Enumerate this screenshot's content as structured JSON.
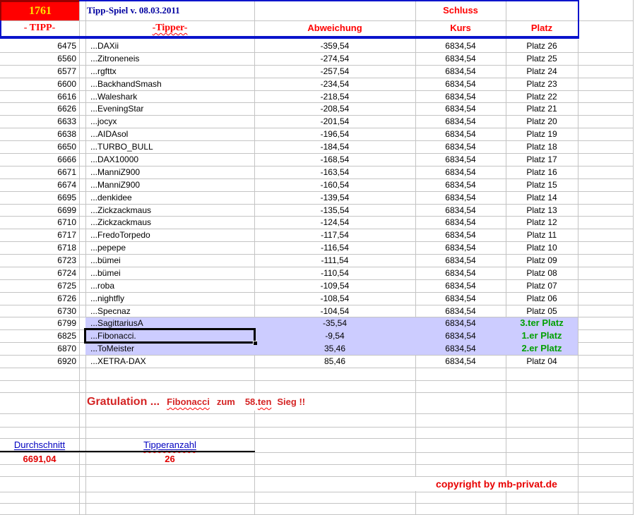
{
  "header": {
    "game_number": "1761",
    "title": "Tipp-Spiel v. 08.03.2011",
    "col_tipp": "- TIPP-",
    "col_tipper": "-Tipper-",
    "col_abweichung": "Abweichung",
    "col_schluss": "Schluss",
    "col_kurs": "Kurs",
    "col_platz": "Platz"
  },
  "table": {
    "rows": [
      {
        "tipp": "6475",
        "tipper": "...DAXii",
        "abweichung": "-359,54",
        "kurs": "6834,54",
        "platz": "Platz 26",
        "highlight": false,
        "winner": false,
        "selected": false
      },
      {
        "tipp": "6560",
        "tipper": "...Zitroneneis",
        "abweichung": "-274,54",
        "kurs": "6834,54",
        "platz": "Platz 25",
        "highlight": false,
        "winner": false,
        "selected": false
      },
      {
        "tipp": "6577",
        "tipper": "...rgfttx",
        "abweichung": "-257,54",
        "kurs": "6834,54",
        "platz": "Platz 24",
        "highlight": false,
        "winner": false,
        "selected": false
      },
      {
        "tipp": "6600",
        "tipper": "...BackhandSmash",
        "abweichung": "-234,54",
        "kurs": "6834,54",
        "platz": "Platz 23",
        "highlight": false,
        "winner": false,
        "selected": false
      },
      {
        "tipp": "6616",
        "tipper": "...Waleshark",
        "abweichung": "-218,54",
        "kurs": "6834,54",
        "platz": "Platz 22",
        "highlight": false,
        "winner": false,
        "selected": false
      },
      {
        "tipp": "6626",
        "tipper": "...EveningStar",
        "abweichung": "-208,54",
        "kurs": "6834,54",
        "platz": "Platz 21",
        "highlight": false,
        "winner": false,
        "selected": false
      },
      {
        "tipp": "6633",
        "tipper": "...jocyx",
        "abweichung": "-201,54",
        "kurs": "6834,54",
        "platz": "Platz 20",
        "highlight": false,
        "winner": false,
        "selected": false
      },
      {
        "tipp": "6638",
        "tipper": "...AIDAsol",
        "abweichung": "-196,54",
        "kurs": "6834,54",
        "platz": "Platz 19",
        "highlight": false,
        "winner": false,
        "selected": false
      },
      {
        "tipp": "6650",
        "tipper": "...TURBO_BULL",
        "abweichung": "-184,54",
        "kurs": "6834,54",
        "platz": "Platz 18",
        "highlight": false,
        "winner": false,
        "selected": false
      },
      {
        "tipp": "6666",
        "tipper": "...DAX10000",
        "abweichung": "-168,54",
        "kurs": "6834,54",
        "platz": "Platz 17",
        "highlight": false,
        "winner": false,
        "selected": false
      },
      {
        "tipp": "6671",
        "tipper": "...ManniZ900",
        "abweichung": "-163,54",
        "kurs": "6834,54",
        "platz": "Platz 16",
        "highlight": false,
        "winner": false,
        "selected": false
      },
      {
        "tipp": "6674",
        "tipper": "...ManniZ900",
        "abweichung": "-160,54",
        "kurs": "6834,54",
        "platz": "Platz 15",
        "highlight": false,
        "winner": false,
        "selected": false
      },
      {
        "tipp": "6695",
        "tipper": "...denkidee",
        "abweichung": "-139,54",
        "kurs": "6834,54",
        "platz": "Platz 14",
        "highlight": false,
        "winner": false,
        "selected": false
      },
      {
        "tipp": "6699",
        "tipper": "...Zickzackmaus",
        "abweichung": "-135,54",
        "kurs": "6834,54",
        "platz": "Platz 13",
        "highlight": false,
        "winner": false,
        "selected": false
      },
      {
        "tipp": "6710",
        "tipper": "...Zickzackmaus",
        "abweichung": "-124,54",
        "kurs": "6834,54",
        "platz": "Platz 12",
        "highlight": false,
        "winner": false,
        "selected": false
      },
      {
        "tipp": "6717",
        "tipper": "...FredoTorpedo",
        "abweichung": "-117,54",
        "kurs": "6834,54",
        "platz": "Platz 11",
        "highlight": false,
        "winner": false,
        "selected": false
      },
      {
        "tipp": "6718",
        "tipper": "...pepepe",
        "abweichung": "-116,54",
        "kurs": "6834,54",
        "platz": "Platz 10",
        "highlight": false,
        "winner": false,
        "selected": false
      },
      {
        "tipp": "6723",
        "tipper": "...bümei",
        "abweichung": "-111,54",
        "kurs": "6834,54",
        "platz": "Platz 09",
        "highlight": false,
        "winner": false,
        "selected": false
      },
      {
        "tipp": "6724",
        "tipper": "...bümei",
        "abweichung": "-110,54",
        "kurs": "6834,54",
        "platz": "Platz 08",
        "highlight": false,
        "winner": false,
        "selected": false
      },
      {
        "tipp": "6725",
        "tipper": "...roba",
        "abweichung": "-109,54",
        "kurs": "6834,54",
        "platz": "Platz 07",
        "highlight": false,
        "winner": false,
        "selected": false
      },
      {
        "tipp": "6726",
        "tipper": "...nightfly",
        "abweichung": "-108,54",
        "kurs": "6834,54",
        "platz": "Platz 06",
        "highlight": false,
        "winner": false,
        "selected": false
      },
      {
        "tipp": "6730",
        "tipper": "...Specnaz",
        "abweichung": "-104,54",
        "kurs": "6834,54",
        "platz": "Platz 05",
        "highlight": false,
        "winner": false,
        "selected": false
      },
      {
        "tipp": "6799",
        "tipper": "...SagittariusA",
        "abweichung": "-35,54",
        "kurs": "6834,54",
        "platz": "3.ter Platz",
        "highlight": true,
        "winner": true,
        "selected": false
      },
      {
        "tipp": "6825",
        "tipper": "...Fibonacci.",
        "abweichung": "-9,54",
        "kurs": "6834,54",
        "platz": "1.er Platz",
        "highlight": true,
        "winner": true,
        "selected": true
      },
      {
        "tipp": "6870",
        "tipper": "...ToMeister",
        "abweichung": "35,46",
        "kurs": "6834,54",
        "platz": "2.er Platz",
        "highlight": true,
        "winner": true,
        "selected": false
      },
      {
        "tipp": "6920",
        "tipper": "...XETRA-DAX",
        "abweichung": "85,46",
        "kurs": "6834,54",
        "platz": "Platz 04",
        "highlight": false,
        "winner": false,
        "selected": false
      }
    ]
  },
  "congrats": {
    "prefix": "Gratulation ...",
    "winner_name": "Fibonacci",
    "middle": "zum",
    "count": "58.",
    "count_suffix": "ten",
    "suffix": "Sieg !!"
  },
  "summary": {
    "durchschnitt_label": "Durchschnitt",
    "durchschnitt_value": "6691,04",
    "tipperanzahl_label": "Tipperanzahl",
    "tipperanzahl_value": "26"
  },
  "footer": {
    "copyright": "copyright by mb-privat.de"
  },
  "colors": {
    "header_border_blue": "#0a14cc",
    "game_number_bg": "#ff0000",
    "game_number_text": "#ffe000",
    "title_navy": "#0000a0",
    "header_red": "#ff0000",
    "highlight_lavender": "#ccccff",
    "winner_green": "#00a000",
    "congrats_red": "#d42424",
    "summary_blue": "#0000c0",
    "summary_value_red": "#e00000",
    "gridline_gray": "#c4c4c4"
  }
}
